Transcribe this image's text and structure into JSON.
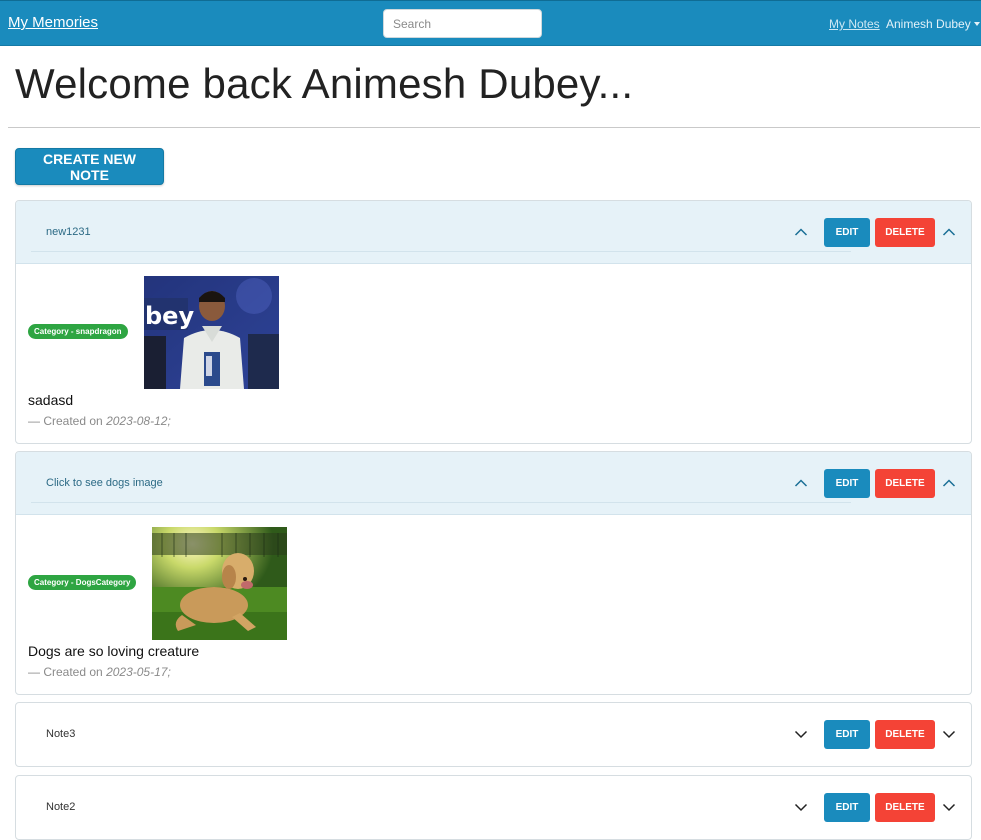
{
  "navbar": {
    "brand": "My Memories",
    "search_placeholder": "Search",
    "my_notes_label": "My Notes",
    "user_name": "Animesh Dubey"
  },
  "page": {
    "title": "Welcome back Animesh Dubey...",
    "create_button_label": "CREATE NEW NOTE"
  },
  "notes": [
    {
      "title": "new1231",
      "expanded": true,
      "category": "Category - snapdragon",
      "content": "sadasd",
      "created_prefix": "— Created on",
      "created_date": "2023-08-12;",
      "edit_label": "EDIT",
      "delete_label": "DELETE"
    },
    {
      "title": "Click to see dogs image",
      "expanded": true,
      "category": "Category - DogsCategory",
      "content": "Dogs are so loving creature",
      "created_prefix": "— Created on",
      "created_date": "2023-05-17;",
      "edit_label": "EDIT",
      "delete_label": "DELETE"
    },
    {
      "title": "Note3",
      "expanded": false,
      "edit_label": "EDIT",
      "delete_label": "DELETE"
    },
    {
      "title": "Note2",
      "expanded": false,
      "edit_label": "EDIT",
      "delete_label": "DELETE"
    }
  ],
  "colors": {
    "primary": "#1a8bbd",
    "danger": "#f44336",
    "badge": "#2ea542",
    "header_bg": "#e6f2f8"
  },
  "icons": {
    "expanded": "chevron-up-icon",
    "collapsed": "chevron-down-icon"
  }
}
